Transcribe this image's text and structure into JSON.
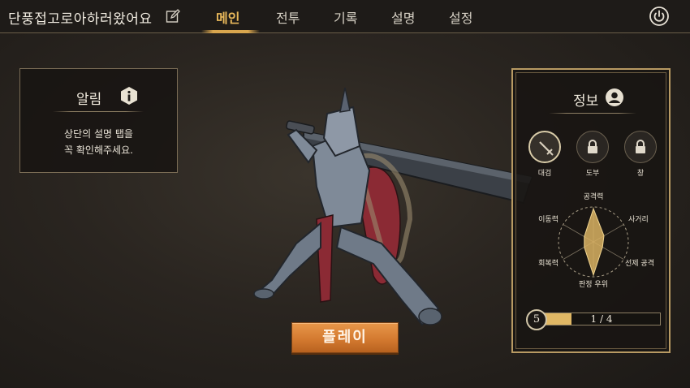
{
  "header": {
    "player_name": "단풍접고로아하러왔어요",
    "tabs": [
      {
        "label": "메인",
        "active": true
      },
      {
        "label": "전투",
        "active": false
      },
      {
        "label": "기록",
        "active": false
      },
      {
        "label": "설명",
        "active": false
      },
      {
        "label": "설정",
        "active": false
      }
    ],
    "icons": {
      "edit": "edit-icon",
      "power": "power-icon"
    }
  },
  "notice": {
    "title": "알림",
    "text": "상단의 설명 탭을\n꼭 확인해주세요.",
    "icon": "info-icon"
  },
  "info_panel": {
    "title": "정보",
    "icon": "profile-icon",
    "weapons": [
      {
        "label": "대검",
        "icon": "greatsword-icon",
        "locked": false,
        "selected": true
      },
      {
        "label": "도부",
        "icon": "lock-icon",
        "locked": true,
        "selected": false
      },
      {
        "label": "창",
        "icon": "lock-icon",
        "locked": true,
        "selected": false
      }
    ],
    "stats": {
      "labels": [
        "공격력",
        "사거리",
        "선제 공격",
        "판정 우위",
        "회복력",
        "이동력"
      ],
      "values": [
        0.95,
        0.35,
        0.3,
        0.95,
        0.3,
        0.3
      ]
    },
    "level": "5",
    "progress": {
      "text": "1 / 4",
      "fraction": 0.25
    }
  },
  "play_button": {
    "label": "플레이"
  },
  "colors": {
    "accent": "#e8b85a",
    "play": "#d47a30",
    "stat_fill": "#d9b263"
  }
}
